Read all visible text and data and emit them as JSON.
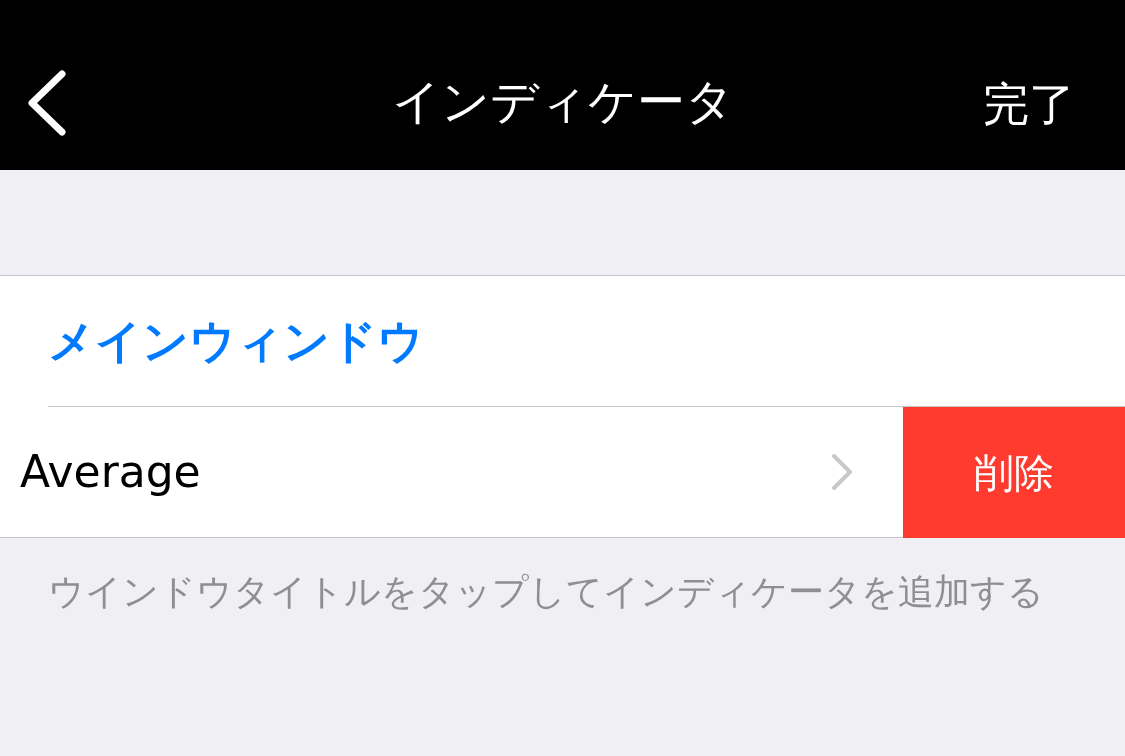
{
  "nav_bar": {
    "title": "インディケータ",
    "done": "完了"
  },
  "section": {
    "header": "メインウィンドウ",
    "rows": [
      {
        "label": "Average",
        "delete_action": "削除"
      }
    ],
    "footer": "ウインドウタイトルをタップしてインディケータを追加する"
  }
}
